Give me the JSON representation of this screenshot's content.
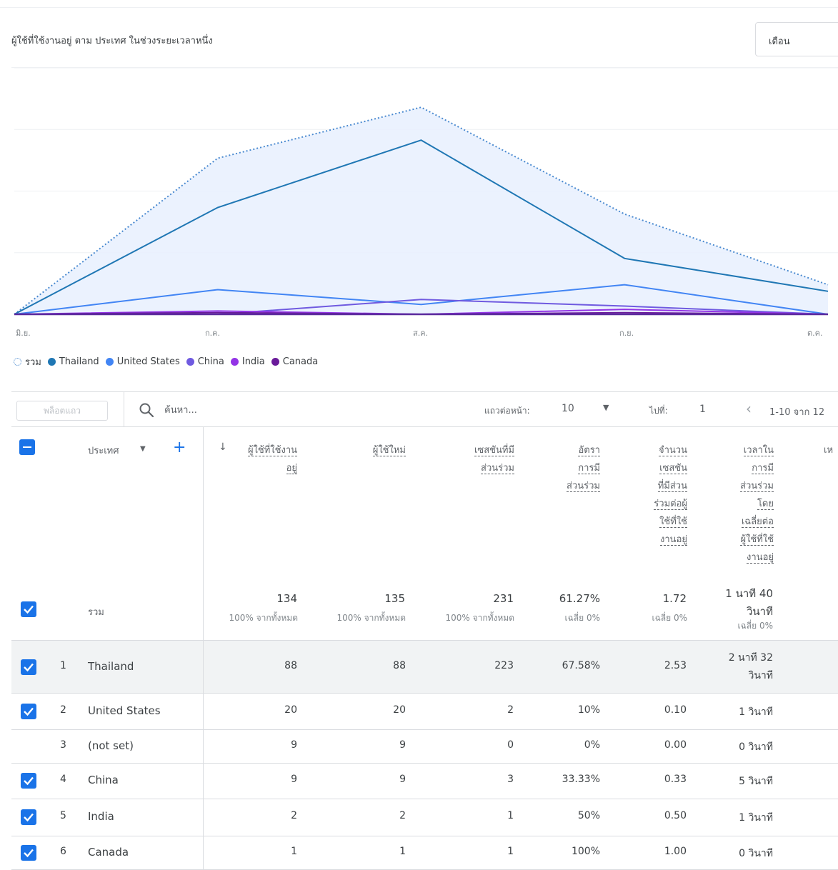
{
  "card": {
    "title": "ผู้ใช้ที่ใช้งานอยู่ ตาม ประเทศ ในช่วงระยะเวลาหนึ่ง",
    "period_select": "เดือน"
  },
  "chart_data": {
    "type": "line",
    "x": [
      "มิ.ย.",
      "ก.ค.",
      "ส.ค.",
      "ก.ย.",
      "ต.ค."
    ],
    "ylim": [
      0,
      150
    ],
    "grid": true,
    "legend_placement": "bottom-left",
    "series": [
      {
        "name": "รวม",
        "values": [
          0,
          95,
          126,
          61,
          18
        ],
        "color": "#4a8ad0",
        "style": "dotted-area"
      },
      {
        "name": "Thailand",
        "values": [
          0,
          65,
          106,
          34,
          14
        ],
        "color": "#1f77b4"
      },
      {
        "name": "United States",
        "values": [
          0,
          15,
          6,
          18,
          0
        ],
        "color": "#4285f4"
      },
      {
        "name": "China",
        "values": [
          0,
          0,
          9,
          5,
          0
        ],
        "color": "#6f5ae0"
      },
      {
        "name": "India",
        "values": [
          0,
          2,
          0,
          3,
          0
        ],
        "color": "#9334e6"
      },
      {
        "name": "Canada",
        "values": [
          0,
          1,
          0,
          1,
          0
        ],
        "color": "#6a1b9a"
      }
    ]
  },
  "toolbar": {
    "pin_rows": "พล็อตแถว",
    "search_placeholder": "ค้นหา...",
    "rows_per_page_label": "แถวต่อหน้า:",
    "rows_per_page": "10",
    "goto_label": "ไปที่:",
    "goto_value": "1",
    "page_range": "1-10 จาก 12"
  },
  "table": {
    "dimension_header": "ประเทศ",
    "headers": {
      "active_users": [
        "ผู้ใช้ที่ใช้งาน",
        "อยู่"
      ],
      "new_users": [
        "ผู้ใช้ใหม่"
      ],
      "engaged_sessions": [
        "เซสชันที่มี",
        "ส่วนร่วม"
      ],
      "engagement_rate": [
        "อัตรา",
        "การมี",
        "ส่วนร่วม"
      ],
      "sessions_per_user": [
        "จำนวน",
        "เซสชัน",
        "ที่มีส่วน",
        "ร่วมต่อผู้",
        "ใช้ที่ใช้",
        "งานอยู่"
      ],
      "avg_time": [
        "เวลาใน",
        "การมี",
        "ส่วนร่วม",
        "โดย",
        "เฉลี่ยต่อ",
        "ผู้ใช้ที่ใช้",
        "งานอยู่"
      ],
      "next_col_partial": "เห"
    },
    "totals": {
      "label": "รวม",
      "active_users": "134",
      "active_users_sub": "100% จากทั้งหมด",
      "new_users": "135",
      "new_users_sub": "100% จากทั้งหมด",
      "engaged_sessions": "231",
      "engaged_sessions_sub": "100% จากทั้งหมด",
      "engagement_rate": "61.27%",
      "engagement_rate_sub": "เฉลี่ย 0%",
      "sessions_per_user": "1.72",
      "sessions_per_user_sub": "เฉลี่ย 0%",
      "avg_time_1": "1 นาที 40",
      "avg_time_2": "วินาที",
      "avg_time_sub": "เฉลี่ย 0%"
    },
    "rows": [
      {
        "idx": "1",
        "country": "Thailand",
        "checked": true,
        "active": "88",
        "new": "88",
        "engaged": "223",
        "rate": "67.58%",
        "spu": "2.53",
        "time1": "2 นาที 32",
        "time2": "วินาที"
      },
      {
        "idx": "2",
        "country": "United States",
        "checked": true,
        "active": "20",
        "new": "20",
        "engaged": "2",
        "rate": "10%",
        "spu": "0.10",
        "time1": "1 วินาที",
        "time2": ""
      },
      {
        "idx": "3",
        "country": "(not set)",
        "checked": false,
        "active": "9",
        "new": "9",
        "engaged": "0",
        "rate": "0%",
        "spu": "0.00",
        "time1": "0 วินาที",
        "time2": ""
      },
      {
        "idx": "4",
        "country": "China",
        "checked": true,
        "active": "9",
        "new": "9",
        "engaged": "3",
        "rate": "33.33%",
        "spu": "0.33",
        "time1": "5 วินาที",
        "time2": ""
      },
      {
        "idx": "5",
        "country": "India",
        "checked": true,
        "active": "2",
        "new": "2",
        "engaged": "1",
        "rate": "50%",
        "spu": "0.50",
        "time1": "1 วินาที",
        "time2": ""
      },
      {
        "idx": "6",
        "country": "Canada",
        "checked": true,
        "active": "1",
        "new": "1",
        "engaged": "1",
        "rate": "100%",
        "spu": "1.00",
        "time1": "0 วินาที",
        "time2": ""
      }
    ]
  }
}
